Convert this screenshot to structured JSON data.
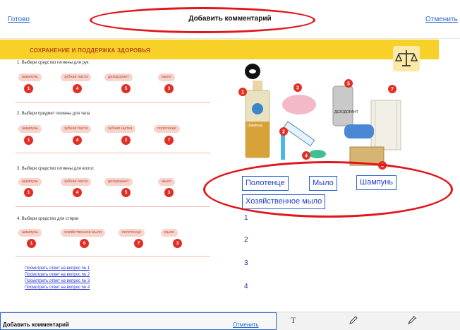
{
  "topbar": {
    "done": "Готово",
    "title": "Добавить комментарий",
    "cancel": "Отменить"
  },
  "worksheet": {
    "header": "СОХРАНЕНИЕ И ПОДДЕРЖКА ЗДОРОВЬЯ",
    "questions": [
      {
        "text": "1. Выбери средство гигиены для рук",
        "options": [
          "шампунь",
          "зубная паста",
          "дезодорант",
          "мыло"
        ],
        "numbers": [
          "1",
          "4",
          "5",
          "3"
        ]
      },
      {
        "text": "2. Выбери предмет гигиены для тела",
        "options": [
          "шампунь",
          "зубная паста",
          "зубная щетка",
          "полотенце"
        ],
        "numbers": [
          "1",
          "4",
          "2",
          "7"
        ]
      },
      {
        "text": "3. Выбери средство гигиены для волос",
        "options": [
          "шампунь",
          "зубная паста",
          "дезодорант",
          "мыло"
        ],
        "numbers": [
          "1",
          "4",
          "5",
          "3"
        ]
      },
      {
        "text": "4. Выбери средство для стирки",
        "options": [
          "шампунь",
          "хозяйственное мыло",
          "полотенце",
          "мыло"
        ],
        "numbers": [
          "1",
          "6",
          "7",
          "3"
        ]
      }
    ],
    "answer_links": [
      "Посмотреть ответ на вопрос № 1",
      "Посмотреть ответ на вопрос № 2",
      "Посмотреть ответ на вопрос № 3",
      "Посмотреть ответ на вопрос № 4"
    ],
    "side_numbers": [
      "1",
      "2",
      "3",
      "4"
    ],
    "image_numbers": [
      "1",
      "2",
      "3",
      "4",
      "5",
      "6",
      "7"
    ],
    "labels": {
      "shampoo_bottle": "Шампунь",
      "deodorant": "ДЕЗОДОРАНТ"
    }
  },
  "answer_chips": [
    "Полотенце",
    "Мыло",
    "Шампунь",
    "Хозяйственное мыло"
  ],
  "bottom": {
    "title": "Добавить комментарий",
    "cancel": "Отменить",
    "text_tool": "T"
  },
  "colors": {
    "highlight_ellipse": "#e0161c",
    "link": "#2a6ad0",
    "header_band": "#f7d127",
    "number_badge": "#e22f26"
  },
  "icons": [
    "eye-icon",
    "scale-icon",
    "text-tool-icon",
    "pencil-icon",
    "pen-icon"
  ]
}
